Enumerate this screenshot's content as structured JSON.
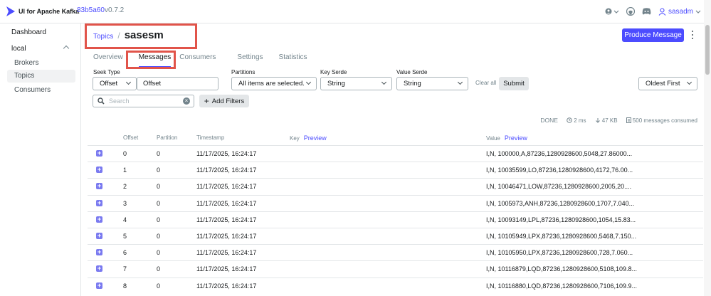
{
  "app": {
    "title": "UI for Apache Kafka",
    "version_hash": "83b5a60",
    "version": "v0.7.2",
    "user": "sasadm"
  },
  "sidebar": {
    "dashboard": "Dashboard",
    "cluster": "local",
    "items": [
      {
        "label": "Brokers"
      },
      {
        "label": "Topics"
      },
      {
        "label": "Consumers"
      }
    ]
  },
  "breadcrumb": {
    "parent": "Topics",
    "separator": "/",
    "current": "sasesm"
  },
  "header": {
    "produce_button": "Produce Message"
  },
  "tabs": [
    {
      "label": "Overview"
    },
    {
      "label": "Messages"
    },
    {
      "label": "Consumers"
    },
    {
      "label": "Settings"
    },
    {
      "label": "Statistics"
    }
  ],
  "filters": {
    "seek_type_label": "Seek Type",
    "seek_type_value": "Offset",
    "offset_value": "Offset",
    "partitions_label": "Partitions",
    "partitions_value": "All items are selected.",
    "key_serde_label": "Key Serde",
    "key_serde_value": "String",
    "value_serde_label": "Value Serde",
    "value_serde_value": "String",
    "clear_all": "Clear all",
    "submit": "Submit",
    "order": "Oldest First",
    "search_placeholder": "Search",
    "add_filters": "Add Filters"
  },
  "stats": {
    "status": "DONE",
    "time": "2 ms",
    "size": "47 KB",
    "consumed": "500 messages consumed"
  },
  "table": {
    "columns": {
      "offset": "Offset",
      "partition": "Partition",
      "timestamp": "Timestamp",
      "key": "Key",
      "value": "Value",
      "preview": "Preview"
    },
    "rows": [
      {
        "offset": "0",
        "partition": "0",
        "timestamp": "11/17/2025, 16:24:17",
        "value": "I,N, 100000,A,87236,1280928600,5048,27.86000..."
      },
      {
        "offset": "1",
        "partition": "0",
        "timestamp": "11/17/2025, 16:24:17",
        "value": "I,N, 10035599,LO,87236,1280928600,4172,76.00..."
      },
      {
        "offset": "2",
        "partition": "0",
        "timestamp": "11/17/2025, 16:24:17",
        "value": "I,N, 10046471,LOW,87236,1280928600,2005,20...."
      },
      {
        "offset": "3",
        "partition": "0",
        "timestamp": "11/17/2025, 16:24:17",
        "value": "I,N, 1005973,ANH,87236,1280928600,1707,7.040..."
      },
      {
        "offset": "4",
        "partition": "0",
        "timestamp": "11/17/2025, 16:24:17",
        "value": "I,N, 10093149,LPL,87236,1280928600,1054,15.83..."
      },
      {
        "offset": "5",
        "partition": "0",
        "timestamp": "11/17/2025, 16:24:17",
        "value": "I,N, 10105949,LPX,87236,1280928600,5468,7.150..."
      },
      {
        "offset": "6",
        "partition": "0",
        "timestamp": "11/17/2025, 16:24:17",
        "value": "I,N, 10105950,LPX,87236,1280928600,728,7.060..."
      },
      {
        "offset": "7",
        "partition": "0",
        "timestamp": "11/17/2025, 16:24:17",
        "value": "I,N, 10116879,LQD,87236,1280928600,5108,109.8..."
      },
      {
        "offset": "8",
        "partition": "0",
        "timestamp": "11/17/2025, 16:24:17",
        "value": "I,N, 10116880,LQD,87236,1280928600,7106,109.9..."
      }
    ]
  },
  "colors": {
    "accent": "#4c4cff",
    "highlight": "#e1544a"
  }
}
